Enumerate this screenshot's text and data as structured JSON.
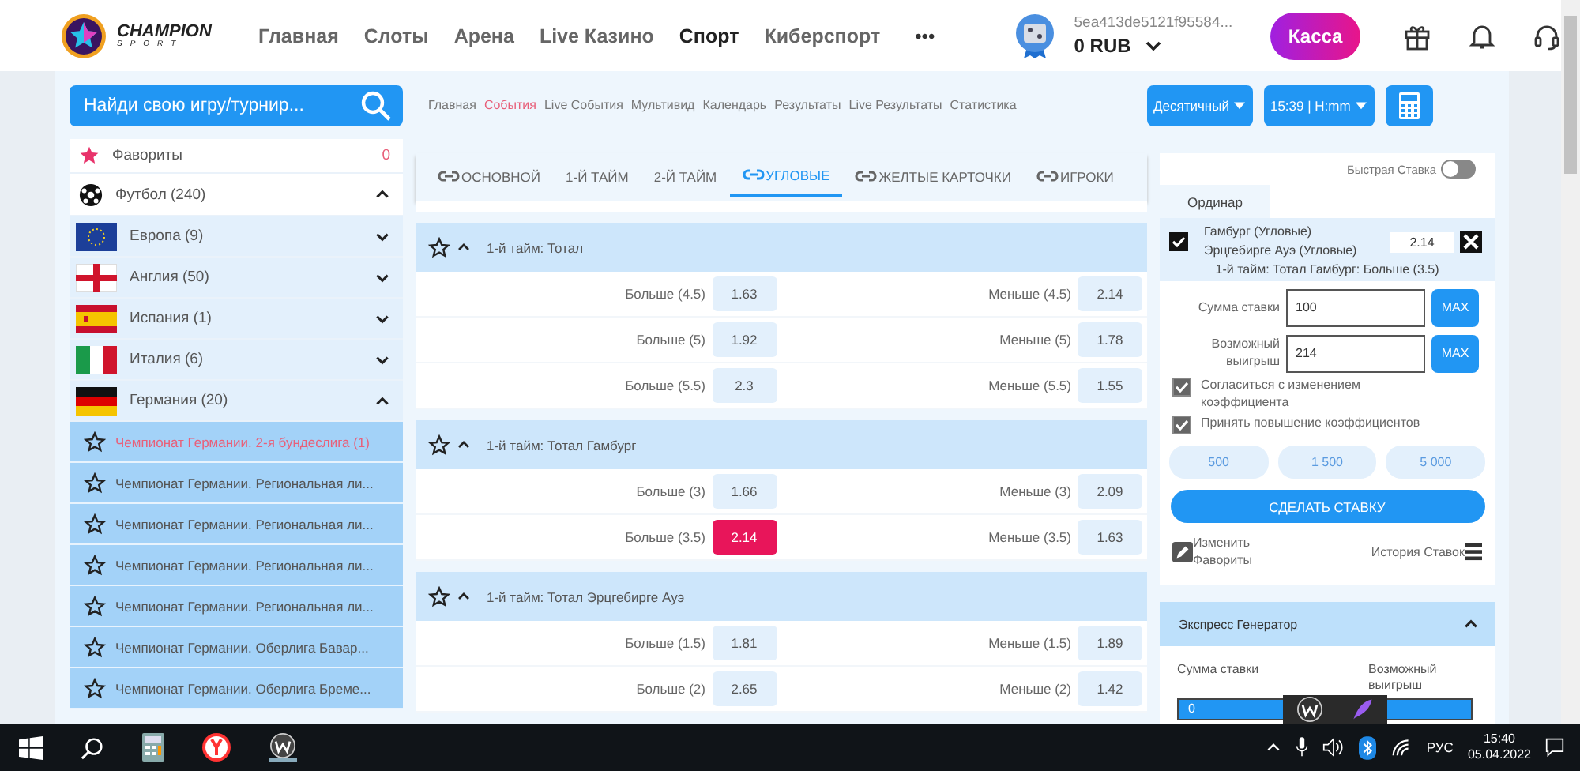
{
  "header": {
    "logo": {
      "name": "CHAMPION",
      "sub": "SPORT"
    },
    "nav": [
      {
        "label": "Главная",
        "selected": false
      },
      {
        "label": "Слоты",
        "selected": false
      },
      {
        "label": "Арена",
        "selected": false
      },
      {
        "label": "Live Казино",
        "selected": false
      },
      {
        "label": "Спорт",
        "selected": true
      },
      {
        "label": "Киберспорт",
        "selected": false
      }
    ],
    "more": "•••",
    "account": {
      "id": "5ea413de5121f95584...",
      "balance": "0 RUB"
    },
    "cashier": "Касса"
  },
  "subbar": {
    "search": {
      "placeholder": "Найди свою игру/турнир..."
    },
    "breadcrumbs": [
      {
        "label": "Главная",
        "selected": false
      },
      {
        "label": "События",
        "selected": true
      },
      {
        "label": "Live События",
        "selected": false
      },
      {
        "label": "Мультивид",
        "selected": false
      },
      {
        "label": "Календарь",
        "selected": false
      },
      {
        "label": "Результаты",
        "selected": false
      },
      {
        "label": "Live Результаты",
        "selected": false
      },
      {
        "label": "Статистика",
        "selected": false
      }
    ],
    "odds_format": "Десятичный",
    "time_format": "15:39 | H:mm"
  },
  "sidebar": {
    "favorites": {
      "label": "Фавориты",
      "count": "0"
    },
    "sports": [
      {
        "label": "Футбол (240)",
        "expanded": true,
        "children": [
          {
            "label": "Европа (9)",
            "kind": "eu",
            "expanded": false
          },
          {
            "label": "Англия (50)",
            "kind": "england",
            "expanded": false
          },
          {
            "label": "Испания (1)",
            "kind": "spain",
            "expanded": false
          },
          {
            "label": "Италия (6)",
            "kind": "italy",
            "expanded": false
          },
          {
            "label": "Германия (20)",
            "kind": "germany",
            "expanded": true,
            "children": [
              {
                "label": "Чемпионат Германии. 2-я бундеслига (1)",
                "selected": true
              },
              {
                "label": "Чемпионат Германии. Региональная ли...",
                "selected": false
              },
              {
                "label": "Чемпионат Германии. Региональная ли...",
                "selected": false
              },
              {
                "label": "Чемпионат Германии. Региональная ли...",
                "selected": false
              },
              {
                "label": "Чемпионат Германии. Региональная ли...",
                "selected": false
              },
              {
                "label": "Чемпионат Германии. Оберлига Бавар...",
                "selected": false
              },
              {
                "label": "Чемпионат Германии. Оберлига Бреме...",
                "selected": false
              }
            ]
          }
        ]
      }
    ]
  },
  "market_tabs": [
    {
      "label": "ОСНОВНОЙ",
      "linked": true,
      "selected": false
    },
    {
      "label": "1-Й ТАЙМ",
      "linked": false,
      "selected": false
    },
    {
      "label": "2-Й ТАЙМ",
      "linked": false,
      "selected": false
    },
    {
      "label": "УГЛОВЫЕ",
      "linked": true,
      "selected": true
    },
    {
      "label": "ЖЕЛТЫЕ КАРТОЧКИ",
      "linked": true,
      "selected": false
    },
    {
      "label": "ИГРОКИ",
      "linked": true,
      "selected": false
    }
  ],
  "markets": [
    {
      "title": "1-й тайм: Тотал",
      "expanded": true,
      "rows": [
        [
          {
            "label": "Больше (4.5)",
            "odds": "1.63",
            "selected": false
          },
          {
            "label": "Меньше (4.5)",
            "odds": "2.14",
            "selected": false
          }
        ],
        [
          {
            "label": "Больше (5)",
            "odds": "1.92",
            "selected": false
          },
          {
            "label": "Меньше (5)",
            "odds": "1.78",
            "selected": false
          }
        ],
        [
          {
            "label": "Больше (5.5)",
            "odds": "2.3",
            "selected": false
          },
          {
            "label": "Меньше (5.5)",
            "odds": "1.55",
            "selected": false
          }
        ]
      ]
    },
    {
      "title": "1-й тайм: Тотал Гамбург",
      "expanded": true,
      "rows": [
        [
          {
            "label": "Больше (3)",
            "odds": "1.66",
            "selected": false
          },
          {
            "label": "Меньше (3)",
            "odds": "2.09",
            "selected": false
          }
        ],
        [
          {
            "label": "Больше (3.5)",
            "odds": "2.14",
            "selected": true
          },
          {
            "label": "Меньше (3.5)",
            "odds": "1.63",
            "selected": false
          }
        ]
      ]
    },
    {
      "title": "1-й тайм: Тотал Эрцгебирге Ауэ",
      "expanded": true,
      "rows": [
        [
          {
            "label": "Больше (1.5)",
            "odds": "1.81",
            "selected": false
          },
          {
            "label": "Меньше (1.5)",
            "odds": "1.89",
            "selected": false
          }
        ],
        [
          {
            "label": "Больше (2)",
            "odds": "2.65",
            "selected": false
          },
          {
            "label": "Меньше (2)",
            "odds": "1.42",
            "selected": false
          }
        ]
      ]
    }
  ],
  "betslip": {
    "quick_bet": {
      "label": "Быстрая Ставка",
      "on": false
    },
    "tab": "Ординар",
    "bet": {
      "teams": [
        "Гамбург (Угловые)",
        "Эрцгебирге Ауэ (Угловые)"
      ],
      "odds": "2.14",
      "market": "1-й тайм: Тотал Гамбург: Больше (3.5)",
      "checked": true
    },
    "stake": {
      "label": "Сумма ставки",
      "value": "100",
      "max": "MAX"
    },
    "win": {
      "label": "Возможный выигрыш",
      "value": "214",
      "max": "MAX"
    },
    "options": [
      {
        "label": "Согласиться с изменением коэффициента",
        "checked": true
      },
      {
        "label": "Принять повышение коэффициентов",
        "checked": true
      }
    ],
    "quick_amounts": [
      "500",
      "1 500",
      "5 000"
    ],
    "place_bet": "СДЕЛАТЬ СТАВКУ",
    "edit_favorites": "Изменить Фавориты",
    "history": "История Ставок"
  },
  "express": {
    "title": "Экспресс Генератор",
    "expanded": true,
    "stake_label": "Сумма ставки",
    "win_label": "Возможный выигрыш",
    "stake_value": "0"
  },
  "taskbar": {
    "language": "РУС",
    "time": "15:40",
    "date": "05.04.2022"
  }
}
